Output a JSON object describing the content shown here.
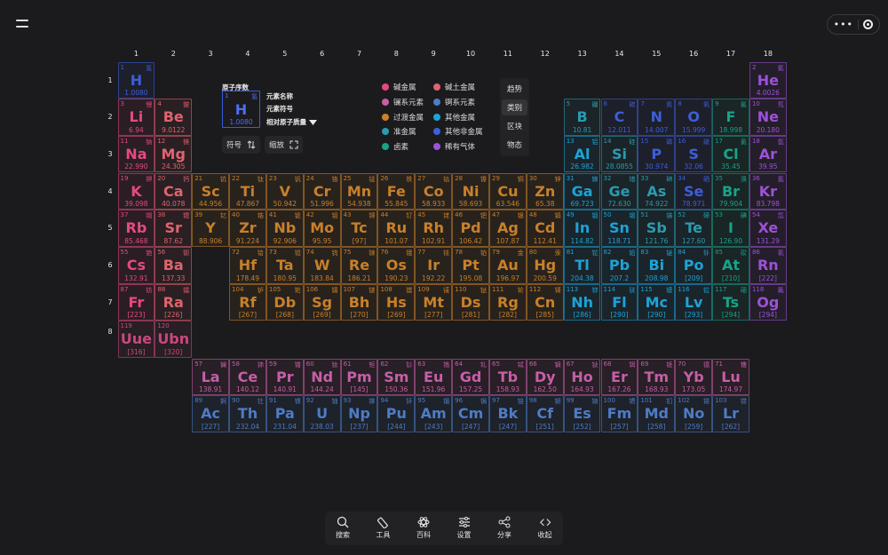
{
  "top": {
    "more_label": "•••"
  },
  "columns": [
    "1",
    "2",
    "3",
    "4",
    "5",
    "6",
    "7",
    "8",
    "9",
    "10",
    "11",
    "12",
    "13",
    "14",
    "15",
    "16",
    "17",
    "18"
  ],
  "rows": [
    "1",
    "2",
    "3",
    "4",
    "5",
    "6",
    "7"
  ],
  "row8": "8",
  "colors": {
    "alkali": "#e64980",
    "alkaline": "#e0636f",
    "lanthanide": "#c65fa6",
    "actinide": "#4d7cc7",
    "transition": "#c8802a",
    "post": "#1ca3d6",
    "metalloid": "#2a9bb0",
    "nonmetal": "#3d5fd9",
    "halogen": "#16a38a",
    "noble": "#9c52d6",
    "unknown": "#c9487e"
  },
  "key": {
    "number_title": "原子序数",
    "name_title": "元素名称",
    "symbol_title": "元素符号",
    "mass_title": "相对原子质量",
    "num": "1",
    "cn": "氢",
    "sym": "H",
    "mass": "1.0080",
    "sort_label": "符号",
    "zoom_label": "缩放"
  },
  "legend": [
    {
      "label": "碱金属",
      "color": "#e64980"
    },
    {
      "label": "碱土金属",
      "color": "#e0636f"
    },
    {
      "label": "镧系元素",
      "color": "#c65fa6"
    },
    {
      "label": "锕系元素",
      "color": "#4d7cc7"
    },
    {
      "label": "过渡金属",
      "color": "#c8802a"
    },
    {
      "label": "其他金属",
      "color": "#1ca3d6"
    },
    {
      "label": "准金属",
      "color": "#2a9bb0"
    },
    {
      "label": "其他非金属",
      "color": "#3d5fd9"
    },
    {
      "label": "卤素",
      "color": "#16a38a"
    },
    {
      "label": "稀有气体",
      "color": "#9c52d6"
    }
  ],
  "view_tabs": [
    {
      "label": "趋势",
      "active": false
    },
    {
      "label": "类别",
      "active": true
    },
    {
      "label": "区块",
      "active": false
    },
    {
      "label": "物态",
      "active": false
    }
  ],
  "elements": [
    [
      "1",
      "H",
      "氢",
      "1.0080",
      "nonmetal",
      1,
      1
    ],
    [
      "2",
      "He",
      "氦",
      "4.0026",
      "noble",
      18,
      1
    ],
    [
      "3",
      "Li",
      "锂",
      "6.94",
      "alkali",
      1,
      2
    ],
    [
      "4",
      "Be",
      "铍",
      "9.0122",
      "alkaline",
      2,
      2
    ],
    [
      "5",
      "B",
      "硼",
      "10.81",
      "metalloid",
      13,
      2
    ],
    [
      "6",
      "C",
      "碳",
      "12.011",
      "nonmetal",
      14,
      2
    ],
    [
      "7",
      "N",
      "氮",
      "14.007",
      "nonmetal",
      15,
      2
    ],
    [
      "8",
      "O",
      "氧",
      "15.999",
      "nonmetal",
      16,
      2
    ],
    [
      "9",
      "F",
      "氟",
      "18.998",
      "halogen",
      17,
      2
    ],
    [
      "10",
      "Ne",
      "氖",
      "20.180",
      "noble",
      18,
      2
    ],
    [
      "11",
      "Na",
      "钠",
      "22.990",
      "alkali",
      1,
      3
    ],
    [
      "12",
      "Mg",
      "镁",
      "24.305",
      "alkaline",
      2,
      3
    ],
    [
      "13",
      "Al",
      "铝",
      "26.982",
      "post",
      13,
      3
    ],
    [
      "14",
      "Si",
      "硅",
      "28.0855",
      "metalloid",
      14,
      3
    ],
    [
      "15",
      "P",
      "磷",
      "30.974",
      "nonmetal",
      15,
      3
    ],
    [
      "16",
      "S",
      "硫",
      "32.06",
      "nonmetal",
      16,
      3
    ],
    [
      "17",
      "Cl",
      "氯",
      "35.45",
      "halogen",
      17,
      3
    ],
    [
      "18",
      "Ar",
      "氩",
      "39.95",
      "noble",
      18,
      3
    ],
    [
      "19",
      "K",
      "钾",
      "39.098",
      "alkali",
      1,
      4
    ],
    [
      "20",
      "Ca",
      "钙",
      "40.078",
      "alkaline",
      2,
      4
    ],
    [
      "21",
      "Sc",
      "钪",
      "44.956",
      "transition",
      3,
      4
    ],
    [
      "22",
      "Ti",
      "钛",
      "47.867",
      "transition",
      4,
      4
    ],
    [
      "23",
      "V",
      "钒",
      "50.942",
      "transition",
      5,
      4
    ],
    [
      "24",
      "Cr",
      "铬",
      "51.996",
      "transition",
      6,
      4
    ],
    [
      "25",
      "Mn",
      "锰",
      "54.938",
      "transition",
      7,
      4
    ],
    [
      "26",
      "Fe",
      "铁",
      "55.845",
      "transition",
      8,
      4
    ],
    [
      "27",
      "Co",
      "钴",
      "58.933",
      "transition",
      9,
      4
    ],
    [
      "28",
      "Ni",
      "镍",
      "58.693",
      "transition",
      10,
      4
    ],
    [
      "29",
      "Cu",
      "铜",
      "63.546",
      "transition",
      11,
      4
    ],
    [
      "30",
      "Zn",
      "锌",
      "65.38",
      "transition",
      12,
      4
    ],
    [
      "31",
      "Ga",
      "镓",
      "69.723",
      "post",
      13,
      4
    ],
    [
      "32",
      "Ge",
      "锗",
      "72.630",
      "metalloid",
      14,
      4
    ],
    [
      "33",
      "As",
      "砷",
      "74.922",
      "metalloid",
      15,
      4
    ],
    [
      "34",
      "Se",
      "硒",
      "78.971",
      "nonmetal",
      16,
      4
    ],
    [
      "35",
      "Br",
      "溴",
      "79.904",
      "halogen",
      17,
      4
    ],
    [
      "36",
      "Kr",
      "氪",
      "83.798",
      "noble",
      18,
      4
    ],
    [
      "37",
      "Rb",
      "铷",
      "85.468",
      "alkali",
      1,
      5
    ],
    [
      "38",
      "Sr",
      "锶",
      "87.62",
      "alkaline",
      2,
      5
    ],
    [
      "39",
      "Y",
      "钇",
      "88.906",
      "transition",
      3,
      5
    ],
    [
      "40",
      "Zr",
      "锆",
      "91.224",
      "transition",
      4,
      5
    ],
    [
      "41",
      "Nb",
      "铌",
      "92.906",
      "transition",
      5,
      5
    ],
    [
      "42",
      "Mo",
      "钼",
      "95.95",
      "transition",
      6,
      5
    ],
    [
      "43",
      "Tc",
      "锝",
      "[97]",
      "transition",
      7,
      5
    ],
    [
      "44",
      "Ru",
      "钌",
      "101.07",
      "transition",
      8,
      5
    ],
    [
      "45",
      "Rh",
      "铑",
      "102.91",
      "transition",
      9,
      5
    ],
    [
      "46",
      "Pd",
      "钯",
      "106.42",
      "transition",
      10,
      5
    ],
    [
      "47",
      "Ag",
      "银",
      "107.87",
      "transition",
      11,
      5
    ],
    [
      "48",
      "Cd",
      "镉",
      "112.41",
      "transition",
      12,
      5
    ],
    [
      "49",
      "In",
      "铟",
      "114.82",
      "post",
      13,
      5
    ],
    [
      "50",
      "Sn",
      "锡",
      "118.71",
      "post",
      14,
      5
    ],
    [
      "51",
      "Sb",
      "锑",
      "121.76",
      "metalloid",
      15,
      5
    ],
    [
      "52",
      "Te",
      "碲",
      "127.60",
      "metalloid",
      16,
      5
    ],
    [
      "53",
      "I",
      "碘",
      "126.90",
      "halogen",
      17,
      5
    ],
    [
      "54",
      "Xe",
      "氙",
      "131.29",
      "noble",
      18,
      5
    ],
    [
      "55",
      "Cs",
      "铯",
      "132.91",
      "alkali",
      1,
      6
    ],
    [
      "56",
      "Ba",
      "钡",
      "137.33",
      "alkaline",
      2,
      6
    ],
    [
      "72",
      "Hf",
      "铪",
      "178.49",
      "transition",
      4,
      6
    ],
    [
      "73",
      "Ta",
      "钽",
      "180.95",
      "transition",
      5,
      6
    ],
    [
      "74",
      "W",
      "钨",
      "183.84",
      "transition",
      6,
      6
    ],
    [
      "75",
      "Re",
      "铼",
      "186.21",
      "transition",
      7,
      6
    ],
    [
      "76",
      "Os",
      "锇",
      "190.23",
      "transition",
      8,
      6
    ],
    [
      "77",
      "Ir",
      "铱",
      "192.22",
      "transition",
      9,
      6
    ],
    [
      "78",
      "Pt",
      "铂",
      "195.08",
      "transition",
      10,
      6
    ],
    [
      "79",
      "Au",
      "金",
      "196.97",
      "transition",
      11,
      6
    ],
    [
      "80",
      "Hg",
      "汞",
      "200.59",
      "transition",
      12,
      6
    ],
    [
      "81",
      "Tl",
      "铊",
      "204.38",
      "post",
      13,
      6
    ],
    [
      "82",
      "Pb",
      "铅",
      "207.2",
      "post",
      14,
      6
    ],
    [
      "83",
      "Bi",
      "铋",
      "208.98",
      "post",
      15,
      6
    ],
    [
      "84",
      "Po",
      "钋",
      "[209]",
      "post",
      16,
      6
    ],
    [
      "85",
      "At",
      "砹",
      "[210]",
      "halogen",
      17,
      6
    ],
    [
      "86",
      "Rn",
      "氡",
      "[222]",
      "noble",
      18,
      6
    ],
    [
      "87",
      "Fr",
      "钫",
      "[223]",
      "alkali",
      1,
      7
    ],
    [
      "88",
      "Ra",
      "镭",
      "[226]",
      "alkaline",
      2,
      7
    ],
    [
      "104",
      "Rf",
      "𬬻",
      "[267]",
      "transition",
      4,
      7
    ],
    [
      "105",
      "Db",
      "𬭊",
      "[268]",
      "transition",
      5,
      7
    ],
    [
      "106",
      "Sg",
      "𬭳",
      "[269]",
      "transition",
      6,
      7
    ],
    [
      "107",
      "Bh",
      "𬭛",
      "[270]",
      "transition",
      7,
      7
    ],
    [
      "108",
      "Hs",
      "𬭶",
      "[269]",
      "transition",
      8,
      7
    ],
    [
      "109",
      "Mt",
      "鿏",
      "[277]",
      "transition",
      9,
      7
    ],
    [
      "110",
      "Ds",
      "𫟼",
      "[281]",
      "transition",
      10,
      7
    ],
    [
      "111",
      "Rg",
      "𬬭",
      "[282]",
      "transition",
      11,
      7
    ],
    [
      "112",
      "Cn",
      "鿔",
      "[285]",
      "transition",
      12,
      7
    ],
    [
      "113",
      "Nh",
      "鿭",
      "[286]",
      "post",
      13,
      7
    ],
    [
      "114",
      "Fl",
      "𫓧",
      "[290]",
      "post",
      14,
      7
    ],
    [
      "115",
      "Mc",
      "镆",
      "[290]",
      "post",
      15,
      7
    ],
    [
      "116",
      "Lv",
      "𫟷",
      "[293]",
      "post",
      16,
      7
    ],
    [
      "117",
      "Ts",
      "鿬",
      "[294]",
      "halogen",
      17,
      7
    ],
    [
      "118",
      "Og",
      "鿫",
      "[294]",
      "noble",
      18,
      7
    ],
    [
      "119",
      "Uue",
      "",
      "[316]",
      "unknown",
      1,
      8
    ],
    [
      "120",
      "Ubn",
      "",
      "[320]",
      "unknown",
      2,
      8
    ],
    [
      "57",
      "La",
      "镧",
      "138.91",
      "lanthanide",
      3,
      9
    ],
    [
      "58",
      "Ce",
      "铈",
      "140.12",
      "lanthanide",
      4,
      9
    ],
    [
      "59",
      "Pr",
      "镨",
      "140.91",
      "lanthanide",
      5,
      9
    ],
    [
      "60",
      "Nd",
      "钕",
      "144.24",
      "lanthanide",
      6,
      9
    ],
    [
      "61",
      "Pm",
      "钷",
      "[145]",
      "lanthanide",
      7,
      9
    ],
    [
      "62",
      "Sm",
      "钐",
      "150.36",
      "lanthanide",
      8,
      9
    ],
    [
      "63",
      "Eu",
      "铕",
      "151.96",
      "lanthanide",
      9,
      9
    ],
    [
      "64",
      "Gd",
      "钆",
      "157.25",
      "lanthanide",
      10,
      9
    ],
    [
      "65",
      "Tb",
      "铽",
      "158.93",
      "lanthanide",
      11,
      9
    ],
    [
      "66",
      "Dy",
      "镝",
      "162.50",
      "lanthanide",
      12,
      9
    ],
    [
      "67",
      "Ho",
      "钬",
      "164.93",
      "lanthanide",
      13,
      9
    ],
    [
      "68",
      "Er",
      "铒",
      "167.26",
      "lanthanide",
      14,
      9
    ],
    [
      "69",
      "Tm",
      "铥",
      "168.93",
      "lanthanide",
      15,
      9
    ],
    [
      "70",
      "Yb",
      "镱",
      "173.05",
      "lanthanide",
      16,
      9
    ],
    [
      "71",
      "Lu",
      "镥",
      "174.97",
      "lanthanide",
      17,
      9
    ],
    [
      "89",
      "Ac",
      "锕",
      "[227]",
      "actinide",
      3,
      10
    ],
    [
      "90",
      "Th",
      "钍",
      "232.04",
      "actinide",
      4,
      10
    ],
    [
      "91",
      "Pa",
      "镤",
      "231.04",
      "actinide",
      5,
      10
    ],
    [
      "92",
      "U",
      "铀",
      "238.03",
      "actinide",
      6,
      10
    ],
    [
      "93",
      "Np",
      "镎",
      "[237]",
      "actinide",
      7,
      10
    ],
    [
      "94",
      "Pu",
      "钚",
      "[244]",
      "actinide",
      8,
      10
    ],
    [
      "95",
      "Am",
      "镅",
      "[243]",
      "actinide",
      9,
      10
    ],
    [
      "96",
      "Cm",
      "锔",
      "[247]",
      "actinide",
      10,
      10
    ],
    [
      "97",
      "Bk",
      "锫",
      "[247]",
      "actinide",
      11,
      10
    ],
    [
      "98",
      "Cf",
      "锎",
      "[251]",
      "actinide",
      12,
      10
    ],
    [
      "99",
      "Es",
      "锿",
      "[252]",
      "actinide",
      13,
      10
    ],
    [
      "100",
      "Fm",
      "镄",
      "[257]",
      "actinide",
      14,
      10
    ],
    [
      "101",
      "Md",
      "钔",
      "[258]",
      "actinide",
      15,
      10
    ],
    [
      "102",
      "No",
      "锘",
      "[259]",
      "actinide",
      16,
      10
    ],
    [
      "103",
      "Lr",
      "铹",
      "[262]",
      "actinide",
      17,
      10
    ]
  ],
  "bottom_bar": [
    {
      "label": "搜索",
      "icon": "search-icon"
    },
    {
      "label": "工具",
      "icon": "tool-icon"
    },
    {
      "label": "百科",
      "icon": "atom-icon"
    },
    {
      "label": "设置",
      "icon": "settings-icon"
    },
    {
      "label": "分享",
      "icon": "share-icon"
    },
    {
      "label": "收起",
      "icon": "collapse-icon"
    }
  ]
}
